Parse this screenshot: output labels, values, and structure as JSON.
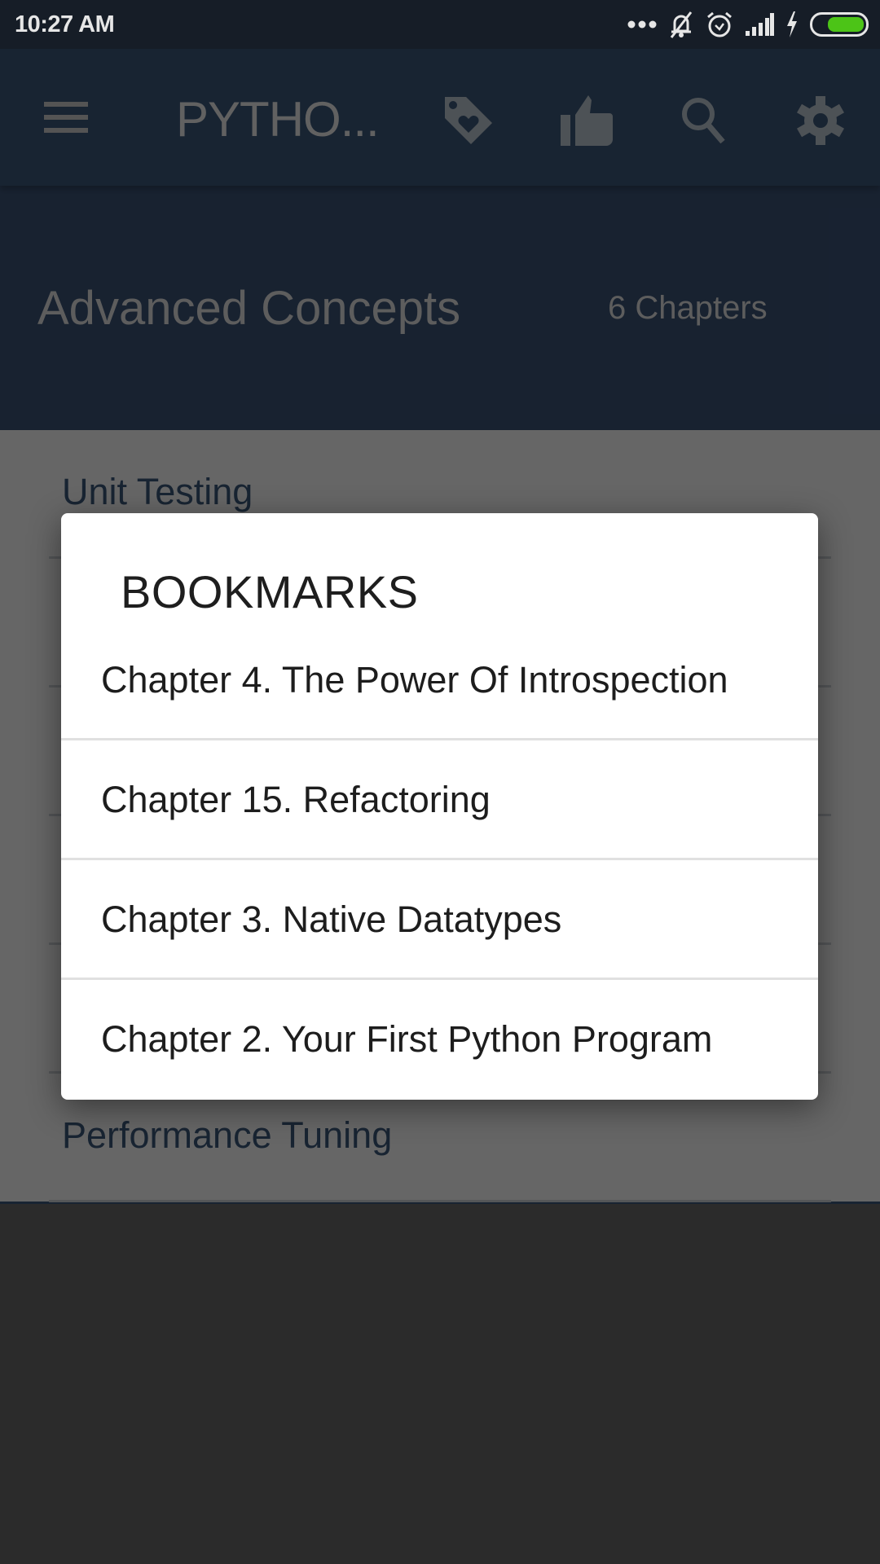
{
  "status_bar": {
    "time": "10:27 AM",
    "icons": [
      "more-dots-icon",
      "notifications-off-icon",
      "alarm-icon",
      "signal-icon",
      "charging-icon",
      "battery-icon"
    ],
    "battery_color": "#4cc417"
  },
  "app_bar": {
    "title": "PYTHO...",
    "icons": [
      "menu-icon",
      "tag-heart-icon",
      "thumb-up-icon",
      "search-icon",
      "settings-icon"
    ],
    "color": "#3b5678"
  },
  "header": {
    "section_title": "Advanced Concepts",
    "chapter_count": "6 Chapters"
  },
  "chapter_list": {
    "items": [
      {
        "label": "Unit Testing"
      },
      {
        "label": ""
      },
      {
        "label": ""
      },
      {
        "label": ""
      },
      {
        "label": ""
      },
      {
        "label": "Performance Tuning"
      }
    ]
  },
  "dialog": {
    "title": "BOOKMARKS",
    "bookmarks": [
      {
        "label": "Chapter 4. The Power Of Introspection"
      },
      {
        "label": "Chapter 15. Refactoring"
      },
      {
        "label": "Chapter 3. Native Datatypes"
      },
      {
        "label": "Chapter 2. Your First Python Program"
      }
    ]
  }
}
